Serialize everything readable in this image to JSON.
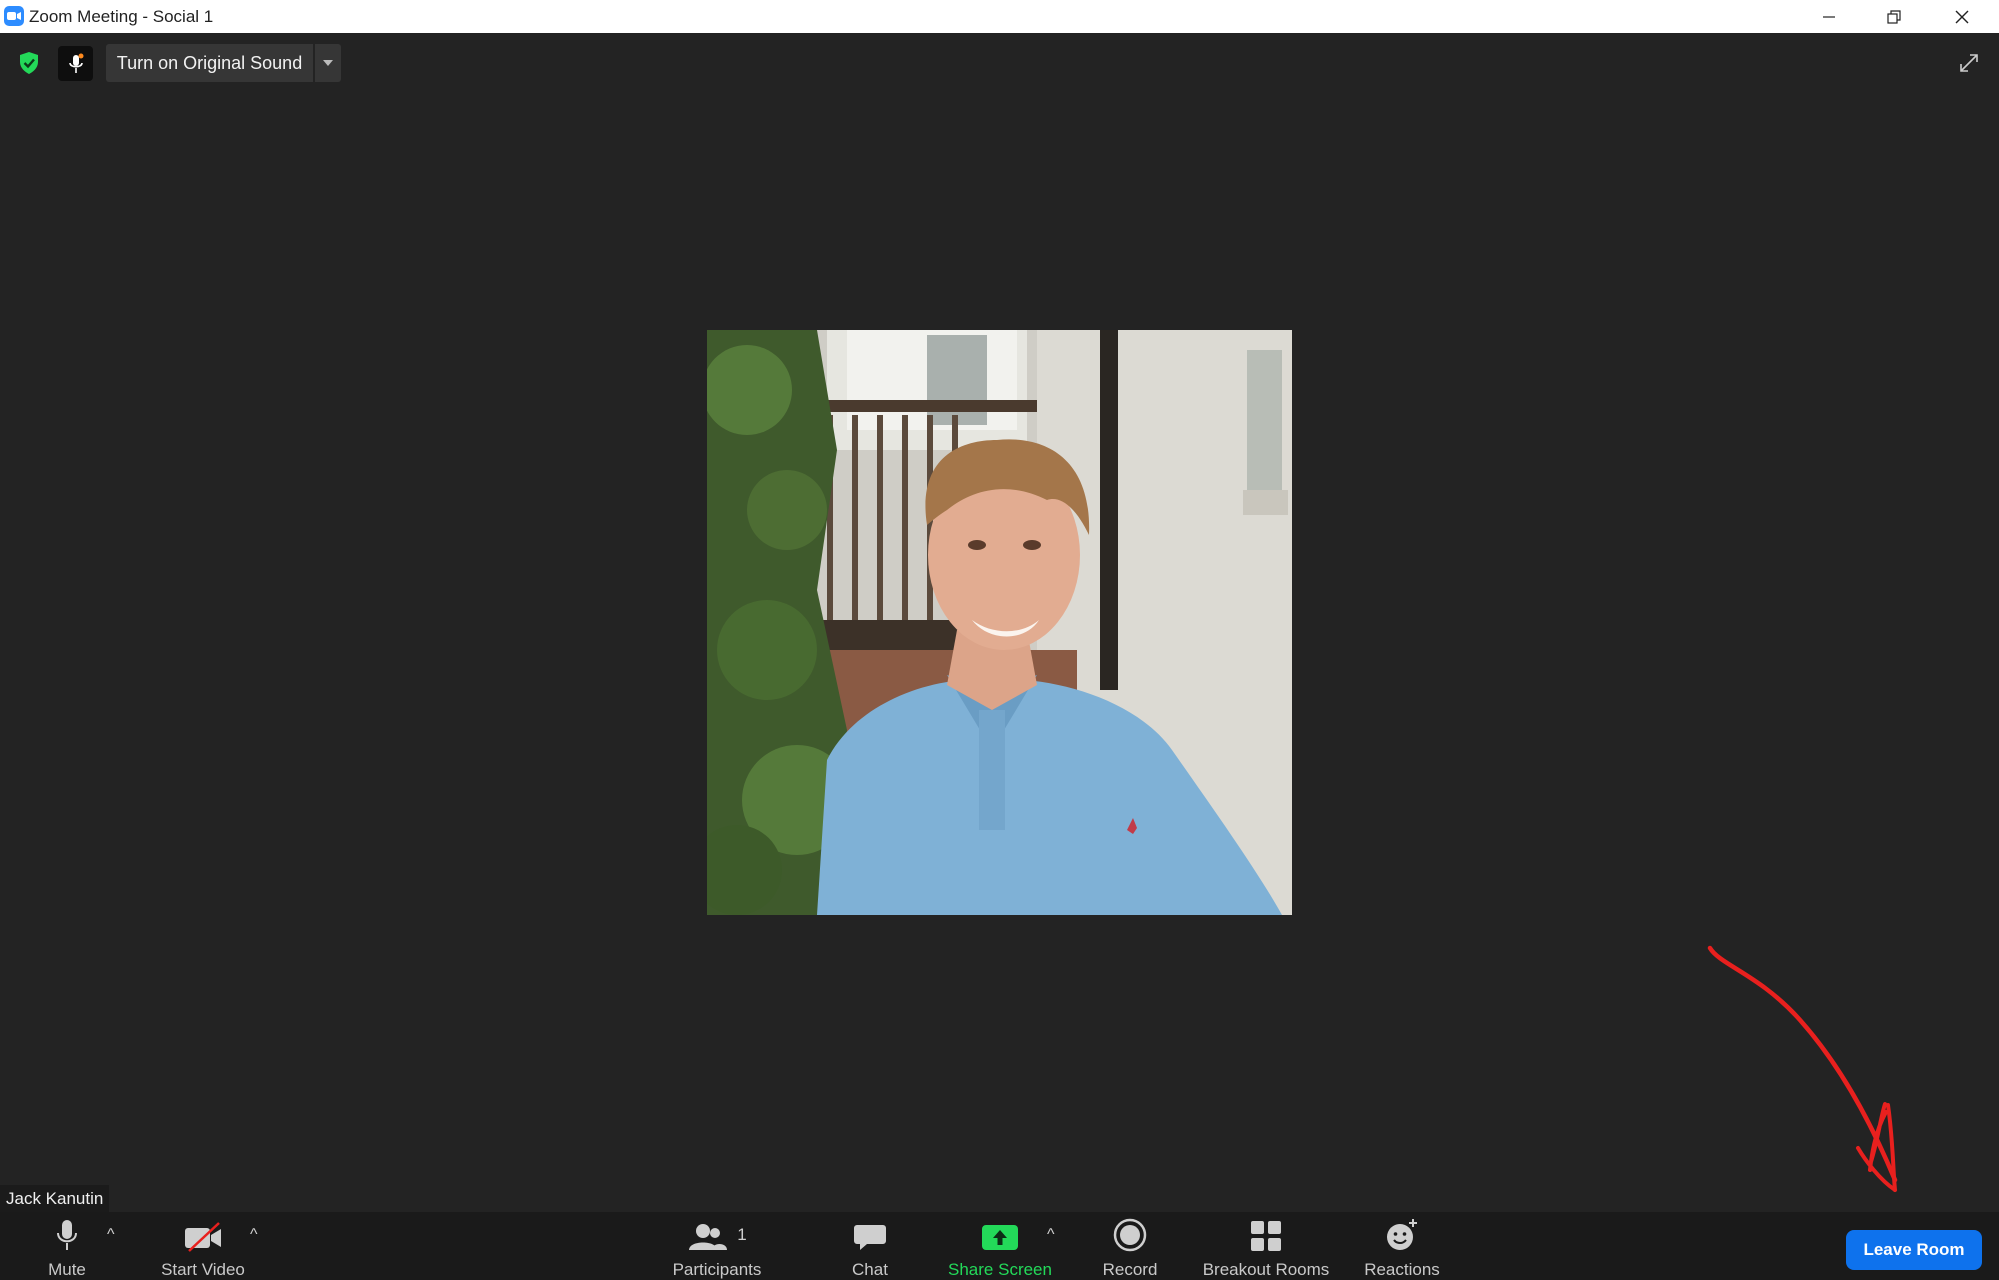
{
  "window": {
    "title": "Zoom Meeting - Social 1"
  },
  "top_bar": {
    "original_sound_label": "Turn on Original Sound"
  },
  "participant": {
    "name": "Jack Kanutin"
  },
  "toolbar": {
    "mute_label": "Mute",
    "start_video_label": "Start Video",
    "participants_label": "Participants",
    "participants_count": "1",
    "chat_label": "Chat",
    "share_screen_label": "Share Screen",
    "record_label": "Record",
    "breakout_rooms_label": "Breakout Rooms",
    "reactions_label": "Reactions",
    "leave_label": "Leave Room",
    "caret": "^"
  },
  "colors": {
    "background": "#232323",
    "toolbar": "#1a1a1a",
    "share_screen": "#23d959",
    "leave_button": "#0e72ed",
    "annotation": "#e8201e",
    "security_shield": "#23d959"
  }
}
